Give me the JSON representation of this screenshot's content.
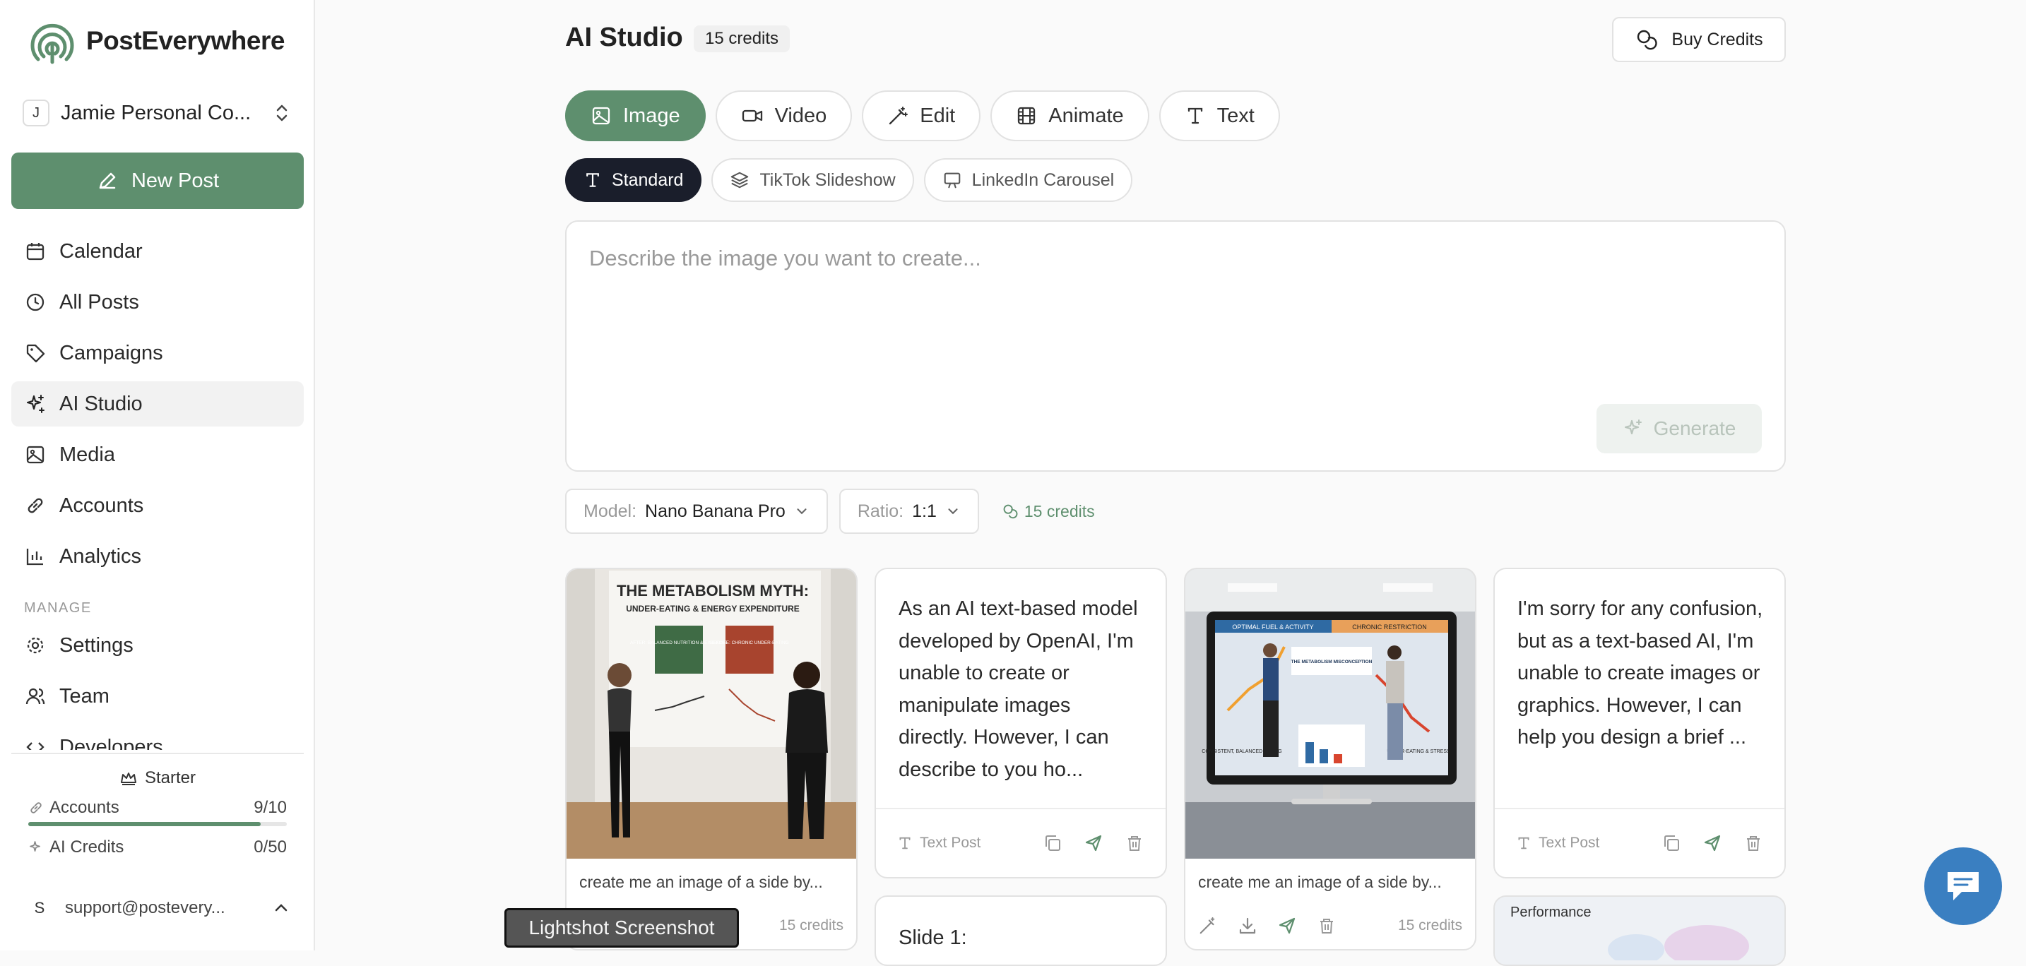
{
  "app": {
    "name": "PostEverywhere"
  },
  "workspace": {
    "badge": "J",
    "name": "Jamie Personal Co..."
  },
  "sidebar": {
    "new_post": "New Post",
    "items": [
      {
        "label": "Calendar",
        "icon": "calendar-icon"
      },
      {
        "label": "All Posts",
        "icon": "clock-icon"
      },
      {
        "label": "Campaigns",
        "icon": "tag-icon"
      },
      {
        "label": "AI Studio",
        "icon": "sparkles-icon",
        "active": true
      },
      {
        "label": "Media",
        "icon": "image-icon"
      },
      {
        "label": "Accounts",
        "icon": "link-icon"
      },
      {
        "label": "Analytics",
        "icon": "bar-chart-icon"
      }
    ],
    "manage_label": "MANAGE",
    "manage_items": [
      {
        "label": "Settings",
        "icon": "gear-icon"
      },
      {
        "label": "Team",
        "icon": "users-icon"
      },
      {
        "label": "Developers",
        "icon": "code-icon"
      }
    ],
    "plan": "Starter",
    "usage": [
      {
        "label": "Accounts",
        "value": "9/10",
        "fraction": 0.9
      },
      {
        "label": "AI Credits",
        "value": "0/50",
        "fraction": 0.0
      }
    ],
    "user": {
      "badge": "S",
      "email": "support@postevery..."
    }
  },
  "header": {
    "title": "AI Studio",
    "credits": "15 credits",
    "buy_label": "Buy Credits"
  },
  "tabs": [
    {
      "label": "Image",
      "icon": "image-icon",
      "active": true
    },
    {
      "label": "Video",
      "icon": "video-icon"
    },
    {
      "label": "Edit",
      "icon": "wand-icon"
    },
    {
      "label": "Animate",
      "icon": "film-icon"
    },
    {
      "label": "Text",
      "icon": "type-icon"
    }
  ],
  "subtabs": [
    {
      "label": "Standard",
      "icon": "type-icon",
      "active": true
    },
    {
      "label": "TikTok Slideshow",
      "icon": "layers-icon"
    },
    {
      "label": "LinkedIn Carousel",
      "icon": "presentation-icon"
    }
  ],
  "prompt": {
    "placeholder": "Describe the image you want to create...",
    "generate_label": "Generate"
  },
  "options": {
    "model_label": "Model:",
    "model_value": "Nano Banana Pro",
    "ratio_label": "Ratio:",
    "ratio_value": "1:1",
    "credits": "15 credits"
  },
  "cards": [
    {
      "kind": "image",
      "image_texts": [
        "THE METABOLISM MYTH:",
        "UNDER-EATING & ENERGY EXPENDITURE",
        "AFTER: BALANCED NUTRITION & EXERCISE",
        "BEFORE: CHRONIC UNDER-EATING"
      ],
      "caption": "create me an image of a side by...",
      "credits": "15 credits"
    },
    {
      "kind": "text",
      "text": "As an AI text-based model developed by OpenAI, I'm unable to create or manipulate images directly. However, I can describe to you ho...",
      "type_label": "Text Post"
    },
    {
      "kind": "image",
      "image_texts": [
        "OPTIMAL FUEL & ACTIVITY",
        "CHRONIC RESTRICTION",
        "THE METABOLISM MISCONCEPTION",
        "CONSISTENT, BALANCED EATING",
        "UNDER-EATING & STRESS"
      ],
      "caption": "create me an image of a side by...",
      "credits": "15 credits"
    },
    {
      "kind": "text",
      "text": "I'm sorry for any confusion, but as a text-based AI, I'm unable to create images or graphics. However, I can help you design a brief ...",
      "type_label": "Text Post"
    }
  ],
  "peek_cards": [
    {
      "text": "Slide 1:"
    },
    {
      "text": "Performance"
    }
  ],
  "tooltip": "Lightshot Screenshot",
  "colors": {
    "brand": "#5e8f6e",
    "dark_chip": "#1a1e2b",
    "chat": "#3a7fc1"
  }
}
